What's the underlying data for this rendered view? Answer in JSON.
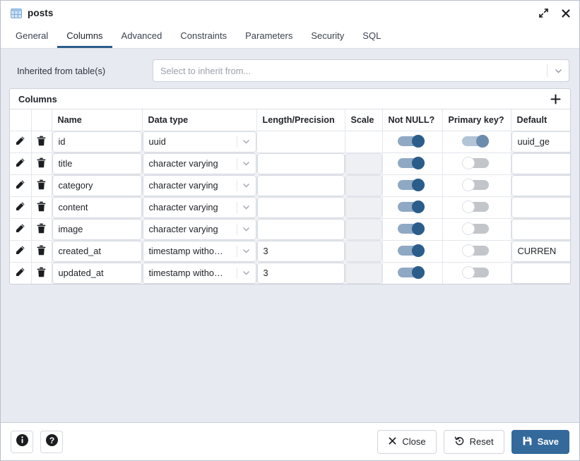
{
  "titlebar": {
    "title": "posts",
    "icon": "table-icon",
    "maximize_icon": "expand-icon",
    "close_icon": "close-icon"
  },
  "tabs": [
    {
      "label": "General",
      "active": false
    },
    {
      "label": "Columns",
      "active": true
    },
    {
      "label": "Advanced",
      "active": false
    },
    {
      "label": "Constraints",
      "active": false
    },
    {
      "label": "Parameters",
      "active": false
    },
    {
      "label": "Security",
      "active": false
    },
    {
      "label": "SQL",
      "active": false
    }
  ],
  "inherit": {
    "label": "Inherited from table(s)",
    "placeholder": "Select to inherit from...",
    "value": ""
  },
  "columns_panel": {
    "title": "Columns",
    "add_label": "+",
    "headers": [
      "",
      "",
      "Name",
      "Data type",
      "Length/Precision",
      "Scale",
      "Not NULL?",
      "Primary key?",
      "Default"
    ],
    "rows": [
      {
        "edit_icon": "pencil-icon",
        "delete_icon": "trash-icon",
        "name": "id",
        "data_type": "uuid",
        "length": "",
        "length_enabled": false,
        "scale": "",
        "scale_enabled": false,
        "not_null": true,
        "not_null_muted": false,
        "primary_key": true,
        "primary_key_muted": true,
        "default": "uuid_ge"
      },
      {
        "edit_icon": "pencil-icon",
        "delete_icon": "trash-icon",
        "name": "title",
        "data_type": "character varying",
        "length": "",
        "length_enabled": true,
        "scale": "",
        "scale_enabled": false,
        "not_null": true,
        "not_null_muted": false,
        "primary_key": false,
        "primary_key_muted": false,
        "default": ""
      },
      {
        "edit_icon": "pencil-icon",
        "delete_icon": "trash-icon",
        "name": "category",
        "data_type": "character varying",
        "length": "",
        "length_enabled": true,
        "scale": "",
        "scale_enabled": false,
        "not_null": true,
        "not_null_muted": false,
        "primary_key": false,
        "primary_key_muted": false,
        "default": ""
      },
      {
        "edit_icon": "pencil-icon",
        "delete_icon": "trash-icon",
        "name": "content",
        "data_type": "character varying",
        "length": "",
        "length_enabled": true,
        "scale": "",
        "scale_enabled": false,
        "not_null": true,
        "not_null_muted": false,
        "primary_key": false,
        "primary_key_muted": false,
        "default": ""
      },
      {
        "edit_icon": "pencil-icon",
        "delete_icon": "trash-icon",
        "name": "image",
        "data_type": "character varying",
        "length": "",
        "length_enabled": true,
        "scale": "",
        "scale_enabled": false,
        "not_null": true,
        "not_null_muted": false,
        "primary_key": false,
        "primary_key_muted": false,
        "default": ""
      },
      {
        "edit_icon": "pencil-icon",
        "delete_icon": "trash-icon",
        "name": "created_at",
        "data_type": "timestamp witho…",
        "length": "3",
        "length_enabled": true,
        "scale": "",
        "scale_enabled": false,
        "not_null": true,
        "not_null_muted": false,
        "primary_key": false,
        "primary_key_muted": false,
        "default": "CURREN"
      },
      {
        "edit_icon": "pencil-icon",
        "delete_icon": "trash-icon",
        "name": "updated_at",
        "data_type": "timestamp witho…",
        "length": "3",
        "length_enabled": true,
        "scale": "",
        "scale_enabled": false,
        "not_null": true,
        "not_null_muted": false,
        "primary_key": false,
        "primary_key_muted": false,
        "default": ""
      }
    ]
  },
  "footer": {
    "info_icon": "info-icon",
    "help_icon": "help-icon",
    "close_label": "Close",
    "reset_label": "Reset",
    "save_label": "Save"
  },
  "colors": {
    "accent": "#34699b",
    "tab_underline": "#2b5d8b",
    "toggle_on": "#2b5d8b",
    "toggle_on_muted": "#6c8cad",
    "toggle_off": "#c2c5ca",
    "body_bg": "#e8eaf1"
  }
}
